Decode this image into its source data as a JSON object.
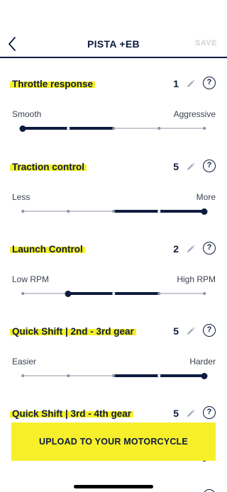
{
  "header": {
    "title": "PISTA +EB",
    "save_label": "SAVE"
  },
  "sections": [
    {
      "title": "Throttle response",
      "value": "1",
      "help": "?",
      "min_label": "Smooth",
      "max_label": "Aggressive",
      "steps": 5,
      "level": 1
    },
    {
      "title": "Traction control",
      "value": "5",
      "help": "?",
      "min_label": "Less",
      "max_label": "More",
      "steps": 5,
      "level": 5
    },
    {
      "title": "Launch Control",
      "value": "2",
      "help": "?",
      "min_label": "Low RPM",
      "max_label": "High RPM",
      "steps": 5,
      "level": 2
    },
    {
      "title": "Quick Shift | 2nd - 3rd gear",
      "value": "5",
      "help": "?",
      "min_label": "Easier",
      "max_label": "Harder",
      "steps": 5,
      "level": 5
    },
    {
      "title": "Quick Shift | 3rd - 4th gear",
      "value": "5",
      "help": "?",
      "min_label": "",
      "max_label": "",
      "steps": 5,
      "level": 5
    }
  ],
  "upload_label": "UPLOAD TO YOUR MOTORCYCLE",
  "colors": {
    "accent": "#f6ef2a",
    "primary": "#0d1b3e",
    "muted": "#c7cbd3"
  },
  "icons": {
    "back": "chevron-left-icon",
    "edit": "pencil-icon",
    "help": "question-icon"
  }
}
